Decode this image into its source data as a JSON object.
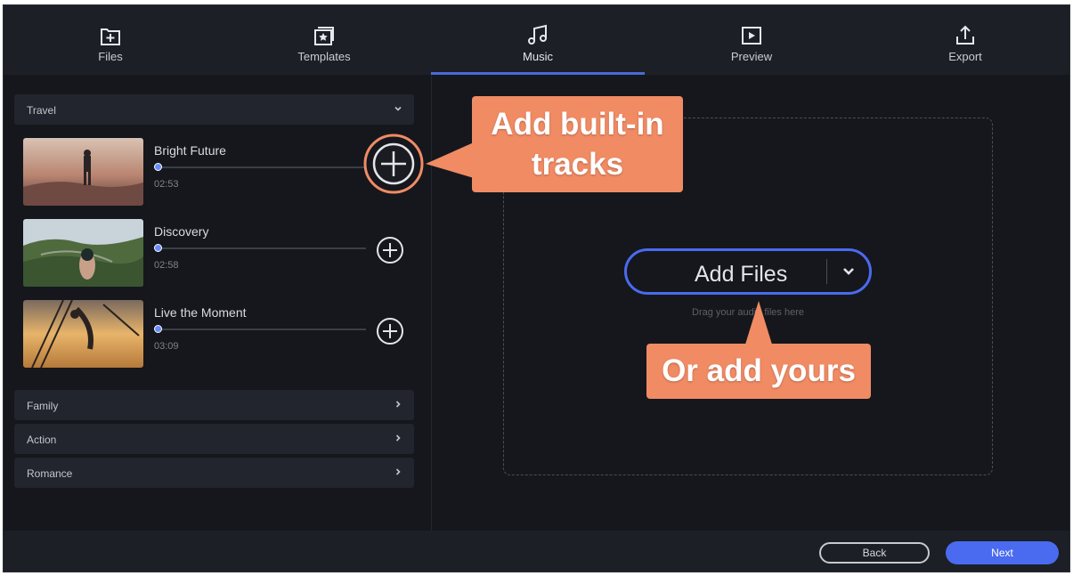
{
  "tabs": [
    {
      "label": "Files",
      "icon": "files-add-icon"
    },
    {
      "label": "Templates",
      "icon": "templates-icon"
    },
    {
      "label": "Music",
      "icon": "music-note-icon",
      "active": true
    },
    {
      "label": "Preview",
      "icon": "play-preview-icon"
    },
    {
      "label": "Export",
      "icon": "export-upload-icon"
    }
  ],
  "categories": {
    "expanded": {
      "label": "Travel"
    },
    "collapsed": [
      {
        "label": "Family"
      },
      {
        "label": "Action"
      },
      {
        "label": "Romance"
      }
    ]
  },
  "tracks": [
    {
      "title": "Bright Future",
      "duration": "02:53",
      "progress": 0
    },
    {
      "title": "Discovery",
      "duration": "02:58",
      "progress": 0
    },
    {
      "title": "Live the Moment",
      "duration": "03:09",
      "progress": 0
    }
  ],
  "dropzone": {
    "add_files_label": "Add Files",
    "drag_hint": "Drag your audio files here"
  },
  "footer": {
    "back_label": "Back",
    "next_label": "Next"
  },
  "callouts": {
    "builtin_line1": "Add built-in",
    "builtin_line2": "tracks",
    "yours": "Or add yours"
  },
  "colors": {
    "accent": "#4a6bf0",
    "callout": "#f08b64",
    "background": "#15171d",
    "panel": "#1c1f26"
  }
}
